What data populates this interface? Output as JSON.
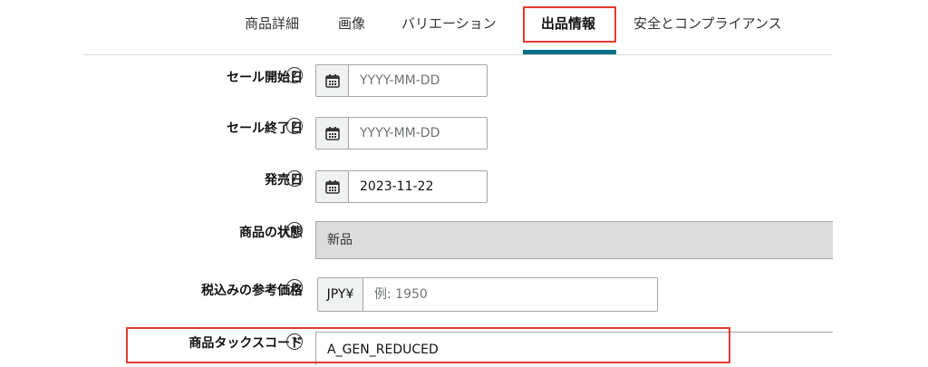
{
  "tabs": [
    {
      "label": "商品詳細",
      "active": false
    },
    {
      "label": "画像",
      "active": false
    },
    {
      "label": "バリエーション",
      "active": false
    },
    {
      "label": "出品情報",
      "active": true
    },
    {
      "label": "安全とコンプライアンス",
      "active": false
    }
  ],
  "form": {
    "sale_start": {
      "label": "セール開始日",
      "help": "?",
      "placeholder": "YYYY-MM-DD",
      "icon": "calendar-icon"
    },
    "sale_end": {
      "label": "セール終了日",
      "help": "?",
      "placeholder": "YYYY-MM-DD",
      "icon": "calendar-icon"
    },
    "release_date": {
      "label": "発売日",
      "help": "?",
      "value": "2023-11-22",
      "icon": "calendar-icon"
    },
    "condition": {
      "label": "商品の状態",
      "help": "?",
      "value": "新品"
    },
    "reference_price": {
      "label": "税込みの参考価格",
      "help": "?",
      "currency": "JPY¥",
      "placeholder": "例: 1950"
    },
    "tax_code": {
      "label": "商品タックスコード",
      "help": "?",
      "value": "A_GEN_REDUCED"
    }
  },
  "colors": {
    "active_underline": "#007185",
    "highlight": "#e03c31"
  }
}
